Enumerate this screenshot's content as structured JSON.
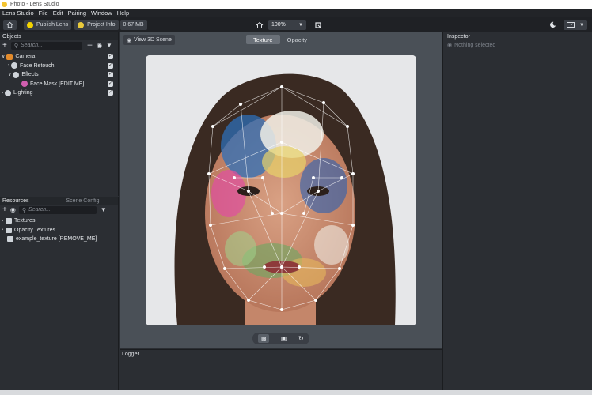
{
  "window": {
    "title": "Photo - Lens Studio"
  },
  "menu": {
    "brand": "Lens Studio",
    "items": [
      "File",
      "Edit",
      "Pairing",
      "Window",
      "Help"
    ]
  },
  "toolbar": {
    "publish_label": "Publish Lens",
    "project_info_label": "Project Info",
    "size": "0.67 MB",
    "zoom": "100%"
  },
  "objects": {
    "title": "Objects",
    "search_placeholder": "Search...",
    "tree": [
      {
        "label": "Camera",
        "level": 0,
        "icon": "camera-icon",
        "expanded": true
      },
      {
        "label": "Face Retouch",
        "level": 1,
        "icon": "face-icon",
        "expanded": false
      },
      {
        "label": "Effects",
        "level": 1,
        "icon": "face-icon",
        "expanded": true
      },
      {
        "label": "Face Mask [EDIT ME]",
        "level": 2,
        "icon": "mask-icon",
        "expanded": false
      },
      {
        "label": "Lighting",
        "level": 0,
        "icon": "light-icon",
        "expanded": false
      }
    ]
  },
  "resources": {
    "tabs": [
      "Resources",
      "Scene Config"
    ],
    "search_placeholder": "Search...",
    "items": [
      {
        "label": "Textures",
        "icon": "folder-icon"
      },
      {
        "label": "Opacity Textures",
        "icon": "folder-icon"
      },
      {
        "label": "example_texture [REMOVE_ME]",
        "icon": "image-icon"
      }
    ]
  },
  "viewport": {
    "view3d_label": "View 3D Scene",
    "tabs": [
      "Texture",
      "Opacity"
    ],
    "active_tab": "Texture"
  },
  "logger": {
    "title": "Logger"
  },
  "inspector": {
    "title": "Inspector",
    "empty_text": "Nothing selected"
  }
}
